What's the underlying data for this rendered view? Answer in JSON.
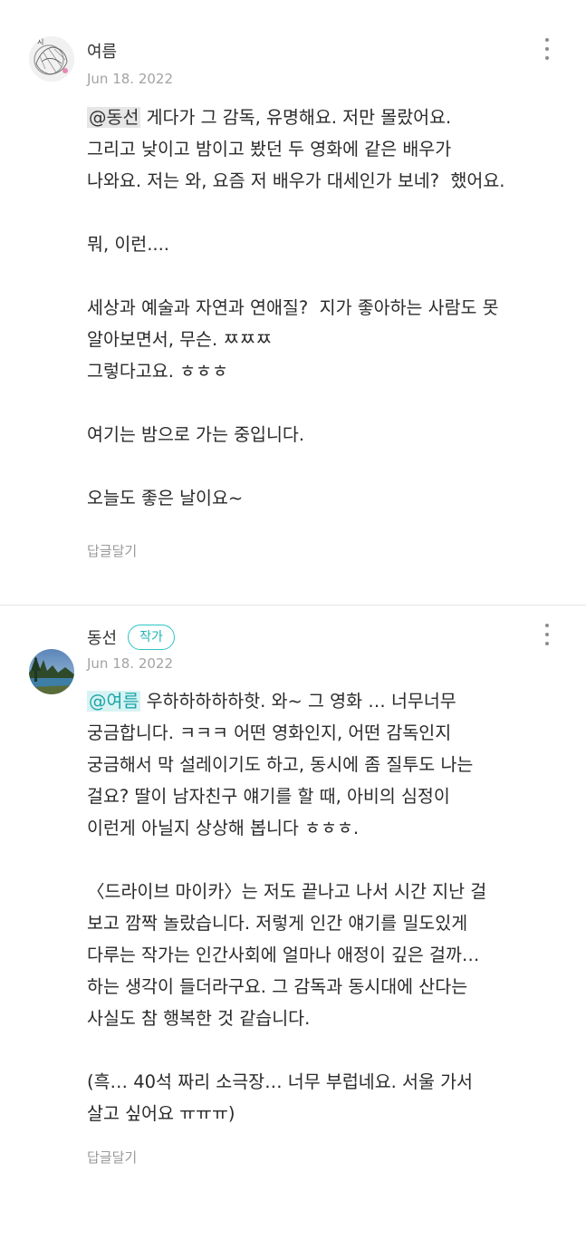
{
  "comments": [
    {
      "author": "여름",
      "date": "Jun 18. 2022",
      "mention": "@동선",
      "text": " 게다가 그 감독, 유명해요. 저만 몰랐어요.\n그리고 낮이고 밤이고 봤던 두 영화에 같은 배우가\n나와요. 저는 와, 요즘 저 배우가 대세인가 보네?  했어요.\n\n뭐, 이런....\n\n세상과 예술과 자연과 연애질?  지가 좋아하는 사람도 못\n알아보면서, 무슨. ㅉㅉㅉ\n그렇다고요. ㅎㅎㅎ\n\n여기는 밤으로 가는 중입니다.\n\n오늘도 좋은 날이요~",
      "reply_label": "답글달기"
    },
    {
      "author": "동선",
      "badge": "작가",
      "date": "Jun 18. 2022",
      "mention": "@여름",
      "text": " 우하하하하하핫. 와~ 그 영화 … 너무너무\n궁금합니다. ㅋㅋㅋ 어떤 영화인지, 어떤 감독인지\n궁금해서 막 설레이기도 하고, 동시에 좀 질투도 나는\n걸요? 딸이 남자친구 얘기를 할 때, 아비의 심정이\n이런게 아닐지 상상해 봅니다 ㅎㅎㅎ.\n\n〈드라이브 마이카〉는 저도 끝나고 나서 시간 지난 걸\n보고 깜짝 놀랐습니다. 저렇게 인간 얘기를 밀도있게\n다루는 작가는 인간사회에 얼마나 애정이 깊은 걸까…\n하는 생각이 들더라구요. 그 감독과 동시대에 산다는\n사실도 참 행복한 것 같습니다.\n\n(흑… 40석 짜리 소극장… 너무 부럽네요. 서울 가서\n살고 싶어요 ㅠㅠㅠ)",
      "reply_label": "답글달기"
    }
  ],
  "icons": {
    "more": "more-vertical-icon"
  },
  "colors": {
    "accent": "#20b3b5",
    "muted": "#a3a3a3"
  }
}
